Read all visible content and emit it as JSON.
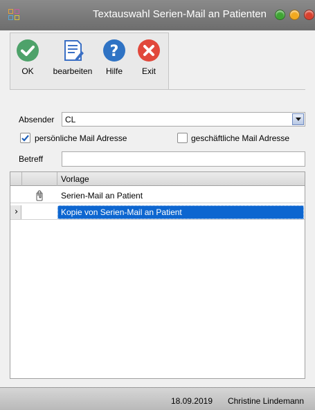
{
  "window": {
    "title": "Textauswahl Serien-Mail an Patienten",
    "buttons": [
      "minimize",
      "maximize",
      "close"
    ],
    "button_colors": [
      "#3fa534",
      "#f1a91f",
      "#d9412f"
    ]
  },
  "toolbar": {
    "items": [
      {
        "label": "OK",
        "icon": "check-icon",
        "color": "#4ea26a"
      },
      {
        "label": "bearbeiten",
        "icon": "document-edit-icon",
        "color": "#3a6fc4"
      },
      {
        "label": "Hilfe",
        "icon": "help-icon",
        "color": "#2f73c4"
      },
      {
        "label": "Exit",
        "icon": "close-icon",
        "color": "#e1483b"
      }
    ]
  },
  "form": {
    "absender_label": "Absender",
    "absender_value": "CL",
    "personal_mail_label": "persönliche Mail Adresse",
    "personal_mail_checked": true,
    "business_mail_label": "geschäftliche Mail Adresse",
    "business_mail_checked": false,
    "betreff_label": "Betreff",
    "betreff_value": ""
  },
  "grid": {
    "column_header": "Vorlage",
    "rows": [
      {
        "text": "Serien-Mail an Patient",
        "icon": "attachment-icon",
        "selected": false
      },
      {
        "text": "Kopie von Serien-Mail an Patient",
        "icon": "",
        "selected": true,
        "indicator": "›"
      }
    ]
  },
  "status": {
    "date": "18.09.2019",
    "user": "Christine Lindemann"
  }
}
